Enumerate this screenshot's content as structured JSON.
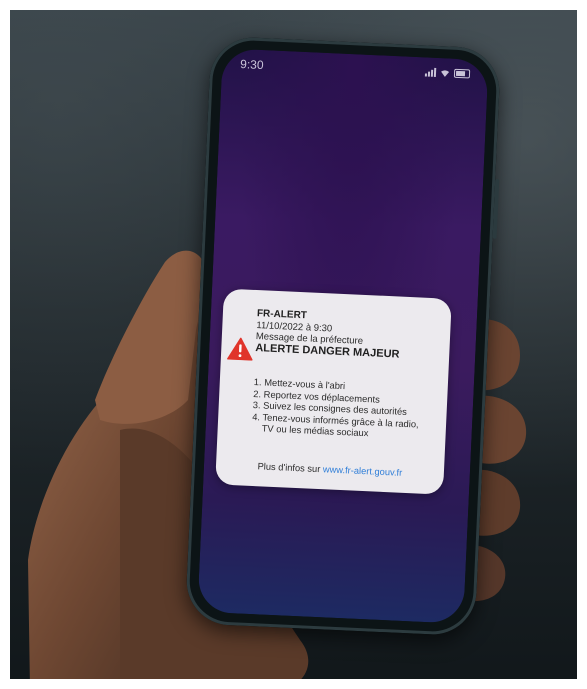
{
  "status_bar": {
    "time": "9:30",
    "icons": [
      "signal-icon",
      "wifi-icon",
      "battery-icon"
    ]
  },
  "alert": {
    "title": "FR-ALERT",
    "timestamp": "11/10/2022 à 9:30",
    "source": "Message de la préfecture",
    "heading": "ALERTE DANGER MAJEUR",
    "icon": "warning-icon",
    "icon_color": "#e0342b",
    "instructions": [
      "1. Mettez-vous à l'abri",
      "2. Reportez vos déplacements",
      "3. Suivez les consignes des autorités",
      "4. Tenez-vous informés grâce à la radio,",
      "TV ou les médias sociaux"
    ],
    "footer_text": "Plus d'infos sur",
    "footer_link": "www.fr-alert.gouv.fr",
    "link_color": "#2f7ed8"
  }
}
